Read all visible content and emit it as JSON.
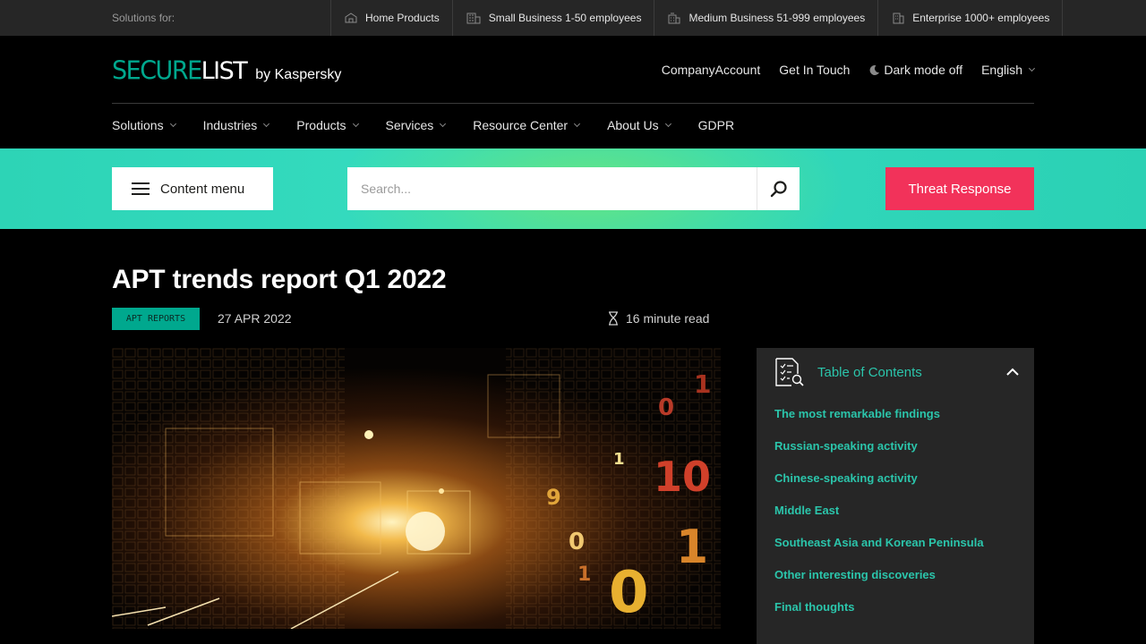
{
  "topbar": {
    "solutions_for": "Solutions for:",
    "segments": [
      {
        "label": "Home Products",
        "icon": "home-icon"
      },
      {
        "label": "Small Business 1-50 employees",
        "icon": "small-office-icon"
      },
      {
        "label": "Medium Business 51-999 employees",
        "icon": "medium-building-icon"
      },
      {
        "label": "Enterprise 1000+ employees",
        "icon": "enterprise-building-icon"
      }
    ]
  },
  "header": {
    "logo_secure": "SECURE",
    "logo_list": "LIST",
    "logo_by": "by Kaspersky",
    "company_account": "CompanyAccount",
    "get_in_touch": "Get In Touch",
    "dark_mode": "Dark mode off",
    "language": "English"
  },
  "nav": {
    "items": [
      {
        "label": "Solutions",
        "has_dropdown": true
      },
      {
        "label": "Industries",
        "has_dropdown": true
      },
      {
        "label": "Products",
        "has_dropdown": true
      },
      {
        "label": "Services",
        "has_dropdown": true
      },
      {
        "label": "Resource Center",
        "has_dropdown": true
      },
      {
        "label": "About Us",
        "has_dropdown": true
      },
      {
        "label": "GDPR",
        "has_dropdown": false
      }
    ]
  },
  "band": {
    "content_menu": "Content menu",
    "search_placeholder": "Search...",
    "threat_response": "Threat Response"
  },
  "article": {
    "title": "APT trends report Q1 2022",
    "tag": "APT REPORTS",
    "date": "27 APR 2022",
    "read_time": "16 minute read"
  },
  "toc": {
    "title": "Table of Contents",
    "items": [
      "The most remarkable findings",
      "Russian-speaking activity",
      "Chinese-speaking activity",
      "Middle East",
      "Southeast Asia and Korean Peninsula",
      "Other interesting discoveries",
      "Final thoughts"
    ]
  },
  "colors": {
    "accent_teal": "#00a88e",
    "toc_link": "#2bc5ab",
    "threat_button": "#f2325a",
    "band": "#2dd4b6"
  }
}
